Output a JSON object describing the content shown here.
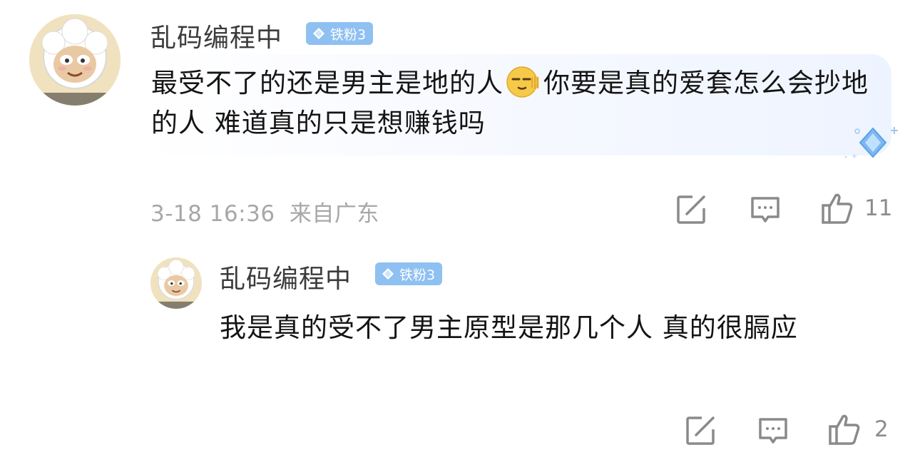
{
  "comments": [
    {
      "username": "乱码编程中",
      "badge": "铁粉3",
      "text_part1": "最受不了的还是男主是地的人",
      "emoji": "relieved-face-emoji",
      "text_part2": "你要是真的爱套怎么会抄地的人 难道真的只是想赚钱吗",
      "date": "3-18 16:36",
      "location": "来自广东",
      "likes": "11"
    },
    {
      "username": "乱码编程中",
      "badge": "铁粉3",
      "text": "我是真的受不了男主原型是那几个人 真的很膈应",
      "likes": "2"
    }
  ],
  "icons": {
    "share": "share-icon",
    "comment": "comment-icon",
    "like": "thumbs-up-icon",
    "badge_gem": "diamond-icon"
  },
  "colors": {
    "badge_bg": "#8fc0f2",
    "meta_text": "#a7a7a7",
    "icon_stroke": "#8a8a8a"
  }
}
